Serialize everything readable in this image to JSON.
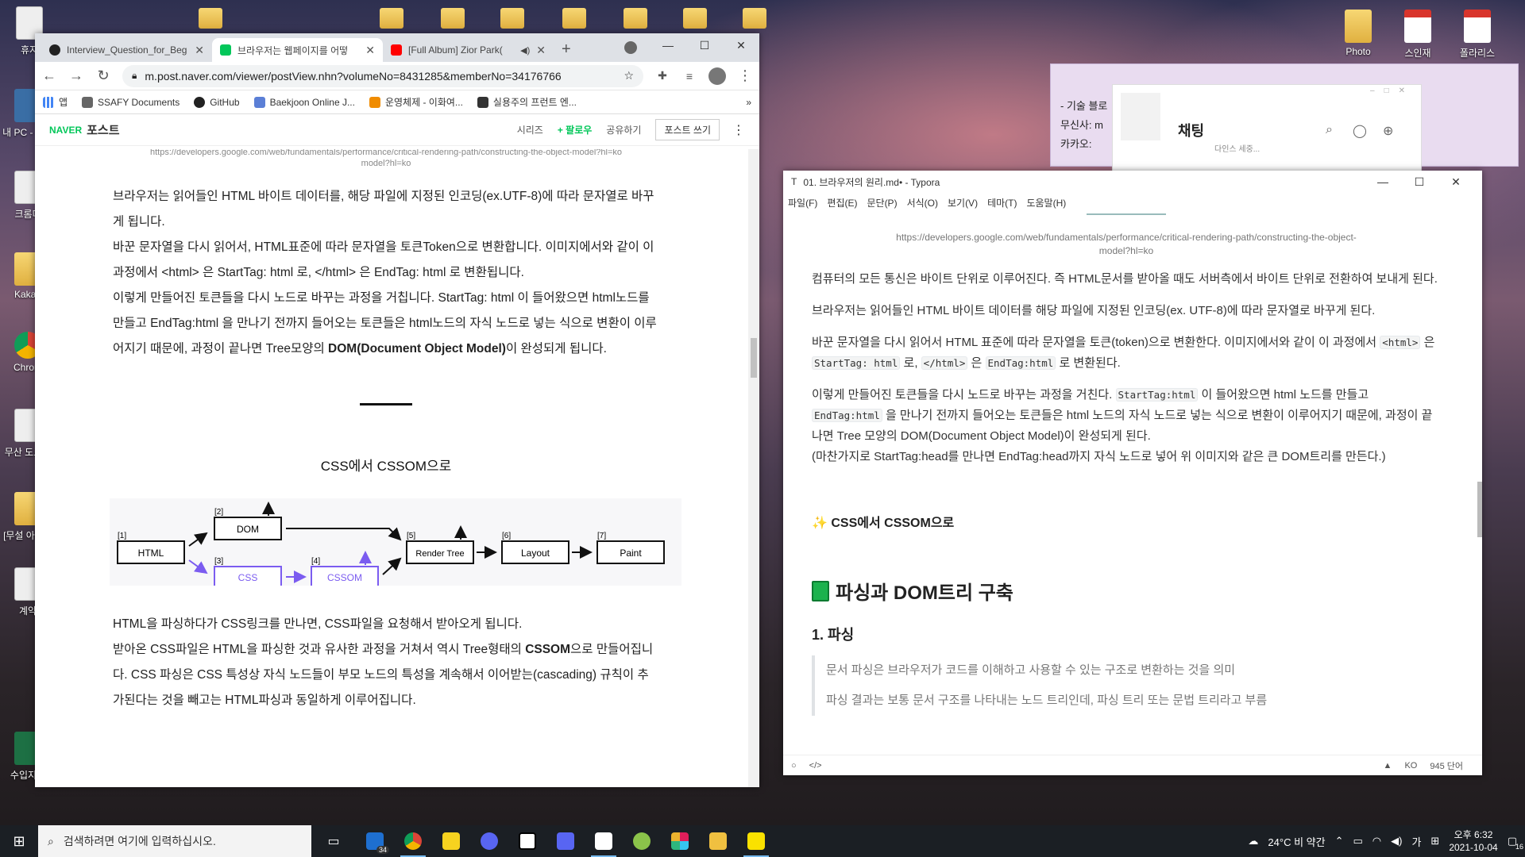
{
  "desktop": {
    "left_icons": [
      "휴지",
      "내 PC - 가기",
      "크롬더",
      "Kakao",
      "Chrom",
      "무산 도로디",
      "[무설 아이즈",
      "계약",
      "수입지출"
    ],
    "right_icons": [
      "Photo",
      "스인재",
      "폴라리스"
    ]
  },
  "browser": {
    "tabs": [
      {
        "title": "Interview_Question_for_Beg",
        "close": "✕"
      },
      {
        "title": "브라우저는 웹페이지를 어떻",
        "close": "✕"
      },
      {
        "title": "[Full Album] Zior Park(",
        "close": "✕"
      }
    ],
    "new_tab": "+",
    "url": "m.post.naver.com/viewer/postView.nhn?volumeNo=8431285&memberNo=34176766",
    "bookmarks": [
      "앱",
      "SSAFY Documents",
      "GitHub",
      "Baekjoon Online J...",
      "운영체제 - 이화여...",
      "실용주의 프런트 엔..."
    ],
    "naver": {
      "logo": "NAVER",
      "title": "포스트",
      "links": [
        "시리즈",
        "+ 팔로우",
        "공유하기"
      ],
      "write": "포스트 쓰기"
    },
    "caption": "https://developers.google.com/web/fundamentals/performance/critical-rendering-path/constructing-the-object-model?hl=ko",
    "caption_short": "model?hl=ko",
    "p1": "브라우저는 읽어들인 HTML 바이트 데이터를, 해당 파일에 지정된 인코딩(ex.UTF-8)에 따라 문자열로 바꾸게 됩니다.",
    "p2": "바꾼 문자열을 다시 읽어서, HTML표준에 따라 문자열을 토큰Token으로 변환합니다. 이미지에서와 같이 이 과정에서 <html> 은 StartTag: html 로, </html> 은 EndTag: html 로 변환됩니다.",
    "p3a": "이렇게 만들어진 토큰들을 다시 노드로 바꾸는 과정을 거칩니다. StartTag: html 이 들어왔으면 html노드를 만들고 EndTag:html 을 만나기 전까지 들어오는 토큰들은 html노드의 자식 노드로 넣는 식으로 변환이 이루어지기 때문에, 과정이 끝나면 Tree모양의 ",
    "p3b": "DOM(Document Object Model)",
    "p3c": "이 완성되게 됩니다.",
    "section": "CSS에서 CSSOM으로",
    "diagram": {
      "nums": [
        "[1]",
        "[2]",
        "[3]",
        "[4]",
        "[5]",
        "[6]",
        "[7]"
      ],
      "html": "HTML",
      "dom": "DOM",
      "css": "CSS",
      "cssom": "CSSOM",
      "render": "Render Tree",
      "layout": "Layout",
      "paint": "Paint"
    },
    "p4": "HTML을 파싱하다가 CSS링크를 만나면, CSS파일을 요청해서 받아오게 됩니다.",
    "p5a": "받아온 CSS파일은 HTML을 파싱한 것과 유사한 과정을 거쳐서 역시 Tree형태의 ",
    "p5b": "CSSOM",
    "p5c": "으로 만들어집니다. CSS 파싱은 CSS 특성상 자식 노드들이 부모 노드의 특성을 계속해서 이어받는(cascading) 규칙이 추가된다는 것을 빼고는 HTML파싱과 동일하게 이루어집니다."
  },
  "chat": {
    "lines": [
      "- 기술 블로",
      "무신사: m",
      "카카오:"
    ],
    "title": "채팅",
    "sub": "다인스 세중..."
  },
  "typora": {
    "title": "01. 브라우저의 원리.md• - Typora",
    "menu": [
      "파일(F)",
      "편집(E)",
      "문단(P)",
      "서식(O)",
      "보기(V)",
      "테마(T)",
      "도움말(H)"
    ],
    "caption1": "https://developers.google.com/web/fundamentals/performance/critical-rendering-path/constructing-the-object-",
    "caption2": "model?hl=ko",
    "p1": "컴퓨터의 모든 통신은 바이트 단위로 이루어진다. 즉 HTML문서를 받아올 때도 서버측에서 바이트 단위로 전환하여 보내게 된다.",
    "p2": "브라우저는 읽어들인 HTML 바이트 데이터를 해당 파일에 지정된 인코딩(ex. UTF-8)에 따라 문자열로 바꾸게 된다.",
    "p3a": "바꾼 문자열을 다시 읽어서 HTML 표준에 따라 문자열을 토큰(token)으로 변환한다. 이미지에서와 같이 이 과정에서 ",
    "p3c1": "<html>",
    "p3t1": " 은 ",
    "p3c2": "StartTag: html",
    "p3t2": " 로, ",
    "p3c3": "</html>",
    "p3t3": " 은 ",
    "p3c4": "EndTag:html",
    "p3t4": " 로 변환된다.",
    "p4a": "이렇게 만들어진 토큰들을 다시 노드로 바꾸는 과정을 거친다. ",
    "p4c1": "StartTag:html",
    "p4b": " 이 들어왔으면 html 노드를 만들고 ",
    "p4c2": "EndTag:html",
    "p4c": " 을 만나기 전까지 들어오는 토큰들은 html 노드의 자식 노드로 넣는 식으로 변환이 이루어지기 때문에, 과정이 끝나면 Tree 모양의 DOM(Document Object Model)이 완성되게 된다.",
    "p4d": "(마찬가지로 StartTag:head를 만나면 EndTag:head까지 자식 노드로 넣어 위 이미지와 같은 큰 DOM트리를 만든다.)",
    "h3": "✨ CSS에서 CSSOM으로",
    "h2": "파싱과 DOM트리 구축",
    "h4": "1. 파싱",
    "bq1": "문서 파싱은 브라우저가 코드를 이해하고 사용할 수 있는 구조로 변환하는 것을 의미",
    "bq2": "파싱 결과는 보통 문서 구조를 나타내는 노드 트리인데, 파싱 트리 또는 문법 트리라고 부름",
    "footer": {
      "lang": "KO",
      "words": "945 단어"
    }
  },
  "taskbar": {
    "search": "검색하려면 여기에 입력하십시오.",
    "mail_badge": "34",
    "weather": "24°C 비 약간",
    "ime": "가",
    "time": "오후 6:32",
    "date": "2021-10-04",
    "notif": "16"
  }
}
